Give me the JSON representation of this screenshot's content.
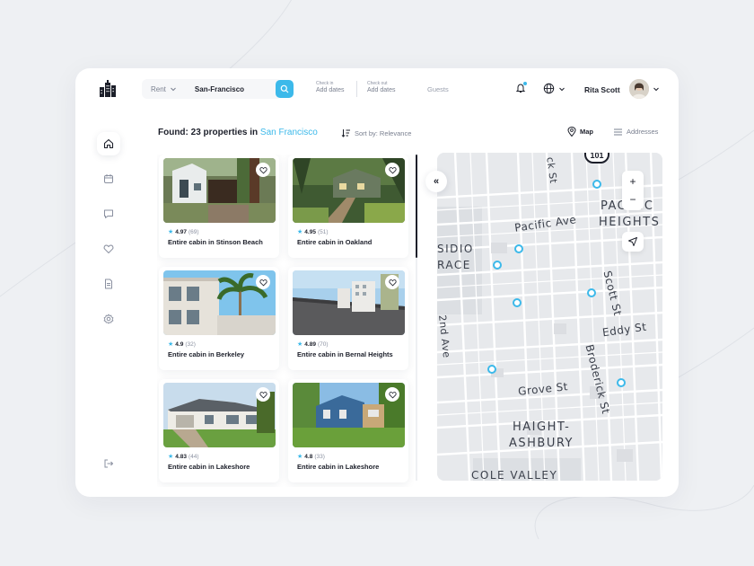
{
  "header": {
    "rent_label": "Rent",
    "city_value": "San-Francisco",
    "checkin_label": "Check in",
    "checkin_value": "Add dates",
    "checkout_label": "Check out",
    "checkout_value": "Add dates",
    "guests_placeholder": "Guests",
    "user_name": "Rita Scott"
  },
  "sidebar": {
    "items": [
      "home-icon",
      "calendar-icon",
      "chat-icon",
      "heart-icon",
      "document-icon",
      "gear-icon"
    ],
    "logout": "logout-icon"
  },
  "results": {
    "found_prefix": "Found: 23 properties in ",
    "found_city": "San Francisco",
    "sort_label": "Sort by: Relevance",
    "map_label": "Map",
    "addresses_label": "Addresses"
  },
  "properties": [
    {
      "rating": "4.97",
      "count": "(69)",
      "title": "Entire cabin in Stinson Beach"
    },
    {
      "rating": "4.95",
      "count": "(51)",
      "title": "Entire cabin in Oakland"
    },
    {
      "rating": "4.9",
      "count": "(32)",
      "title": "Entire cabin in Berkeley"
    },
    {
      "rating": "4.89",
      "count": "(70)",
      "title": "Entire cabin in Bernal Heights"
    },
    {
      "rating": "4.83",
      "count": "(44)",
      "title": "Entire cabin in Lakeshore"
    },
    {
      "rating": "4.8",
      "count": "(33)",
      "title": "Entire cabin in Lakeshore"
    }
  ],
  "map": {
    "labels": {
      "pacific_ave": "Pacific Ave",
      "pacific_heights_1": "PACIFIC",
      "pacific_heights_2": "HEIGHTS",
      "presidio_1": "SIDIO",
      "presidio_2": "RACE",
      "scott_st": "Scott St",
      "eddy_st": "Eddy St",
      "second_ave": "2nd Ave",
      "broderick_st": "Broderick St",
      "grove_st": "Grove St",
      "haight_1": "HAIGHT-",
      "haight_2": "ASHBURY",
      "cole_valley": "COLE VALLEY",
      "top_st": "ck St",
      "highway": "101"
    },
    "zoom_in": "+",
    "zoom_out": "−",
    "collapse": "«"
  },
  "colors": {
    "accent": "#3cb9ea",
    "text": "#1c1f2a"
  }
}
